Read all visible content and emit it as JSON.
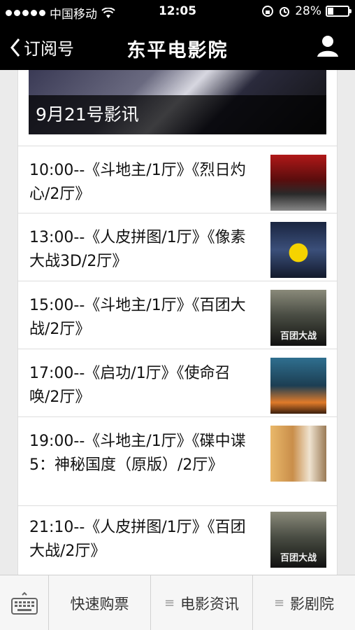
{
  "status_bar": {
    "carrier": "中国移动",
    "time": "12:05",
    "battery": "28%",
    "battery_level": 0.28
  },
  "nav": {
    "back_label": "订阅号",
    "title": "东平电影院"
  },
  "cover": {
    "caption": "9月21号影讯"
  },
  "schedule": [
    {
      "text": "10:00--《斗地主/1厅》《烈日灼心/2厅》",
      "thumb": "red"
    },
    {
      "text": "13:00--《人皮拼图/1厅》《像素大战3D/2厅》",
      "thumb": "pixel"
    },
    {
      "text": "15:00--《斗地主/1厅》《百团大战/2厅》",
      "thumb": "war"
    },
    {
      "text": "17:00--《启功/1厅》《使命召唤/2厅》",
      "thumb": "call"
    },
    {
      "text": "19:00--《斗地主/1厅》《碟中谍5：神秘国度（原版）/2厅》",
      "thumb": "mi"
    },
    {
      "text": "21:10--《人皮拼图/1厅》《百团大战/2厅》",
      "thumb": "war"
    }
  ],
  "poster_caption": "百团大战",
  "tab_bar": {
    "tab1": "快速购票",
    "tab2": "电影资讯",
    "tab3": "影剧院"
  }
}
